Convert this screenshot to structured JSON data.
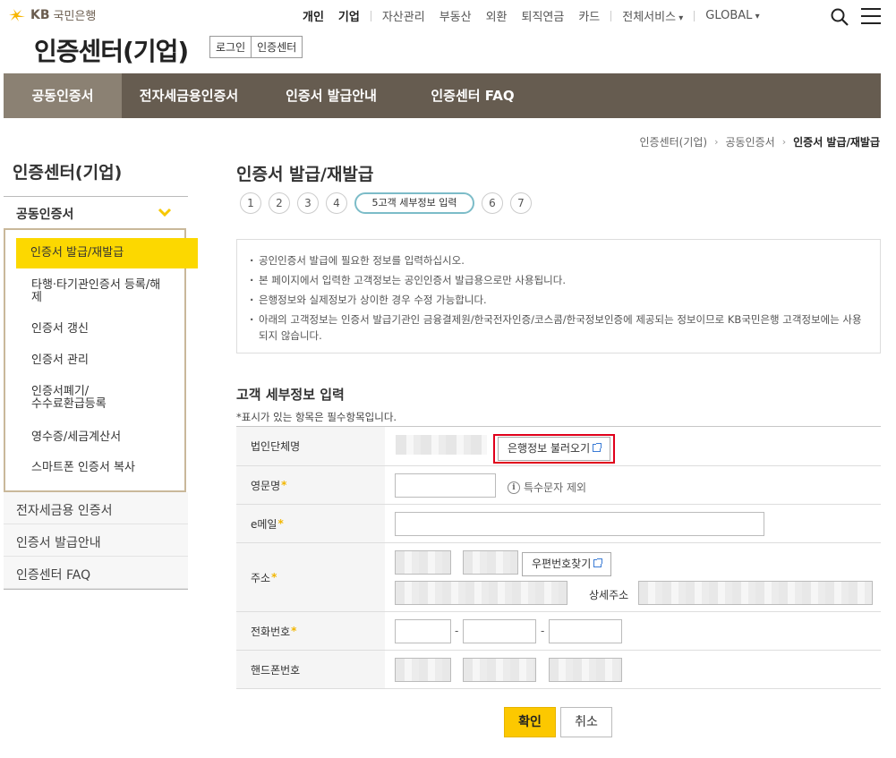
{
  "brand": {
    "kb": "KB",
    "bank": "국민은행",
    "star_color": "#f7b500"
  },
  "topnav": {
    "primary": [
      "개인",
      "기업"
    ],
    "secondary": [
      "자산관리",
      "부동산",
      "외환",
      "퇴직연금",
      "카드"
    ],
    "all_services": "전체서비스",
    "global": "GLOBAL"
  },
  "header": {
    "title": "인증센터(기업)",
    "tabs": [
      "로그인",
      "인증센터"
    ]
  },
  "gnb": {
    "tabs": [
      "공동인증서",
      "전자세금용인증서",
      "인증서 발급안내",
      "인증센터 FAQ"
    ],
    "bg": "#665c50",
    "active_bg": "#8b8173"
  },
  "breadcrumb": [
    "인증센터(기업)",
    "공동인증서",
    "인증서 발급/재발급"
  ],
  "sidebar": {
    "title": "인증센터(기업)",
    "section": "공동인증서",
    "items": [
      "인증서 발급/재발급",
      "타행·타기관인증서 등록/해제",
      "인증서 갱신",
      "인증서 관리",
      "인증서폐기/\n수수료환급등록",
      "영수증/세금계산서",
      "스마트폰 인증서 복사"
    ],
    "more": [
      "전자세금용 인증서",
      "인증서 발급안내",
      "인증센터 FAQ"
    ]
  },
  "main": {
    "title": "인증서 발급/재발급",
    "steps": [
      "1",
      "2",
      "3",
      "4",
      "5고객 세부정보 입력",
      "6",
      "7"
    ],
    "notices": [
      "공인인증서 발급에 필요한 정보를 입력하십시오.",
      "본 페이지에서 입력한 고객정보는 공인인증서 발급용으로만 사용됩니다.",
      "은행정보와 실제정보가 상이한 경우 수정 가능합니다.",
      "아래의 고객정보는 인증서 발급기관인 금융결제원/한국전자인증/코스콤/한국정보인증에 제공되는 정보이므로 KB국민은행 고객정보에는 사용되지 않습니다."
    ],
    "form_title": "고객 세부정보 입력",
    "form_note": "*표시가 있는 항목은 필수항목입니다."
  },
  "form": {
    "corp_name_label": "법인단체명",
    "load_bank_info": "은행정보 불러오기",
    "eng_name_label": "영문명",
    "special_chars_note": "특수문자 제외",
    "email_label": "e메일",
    "address_label": "주소",
    "zip_search": "우편번호찾기",
    "address_detail_label": "상세주소",
    "phone_label": "전화번호",
    "mobile_label": "핸드폰번호",
    "dash": "-",
    "required_mark": "*"
  },
  "buttons": {
    "confirm": "확인",
    "cancel": "취소"
  }
}
